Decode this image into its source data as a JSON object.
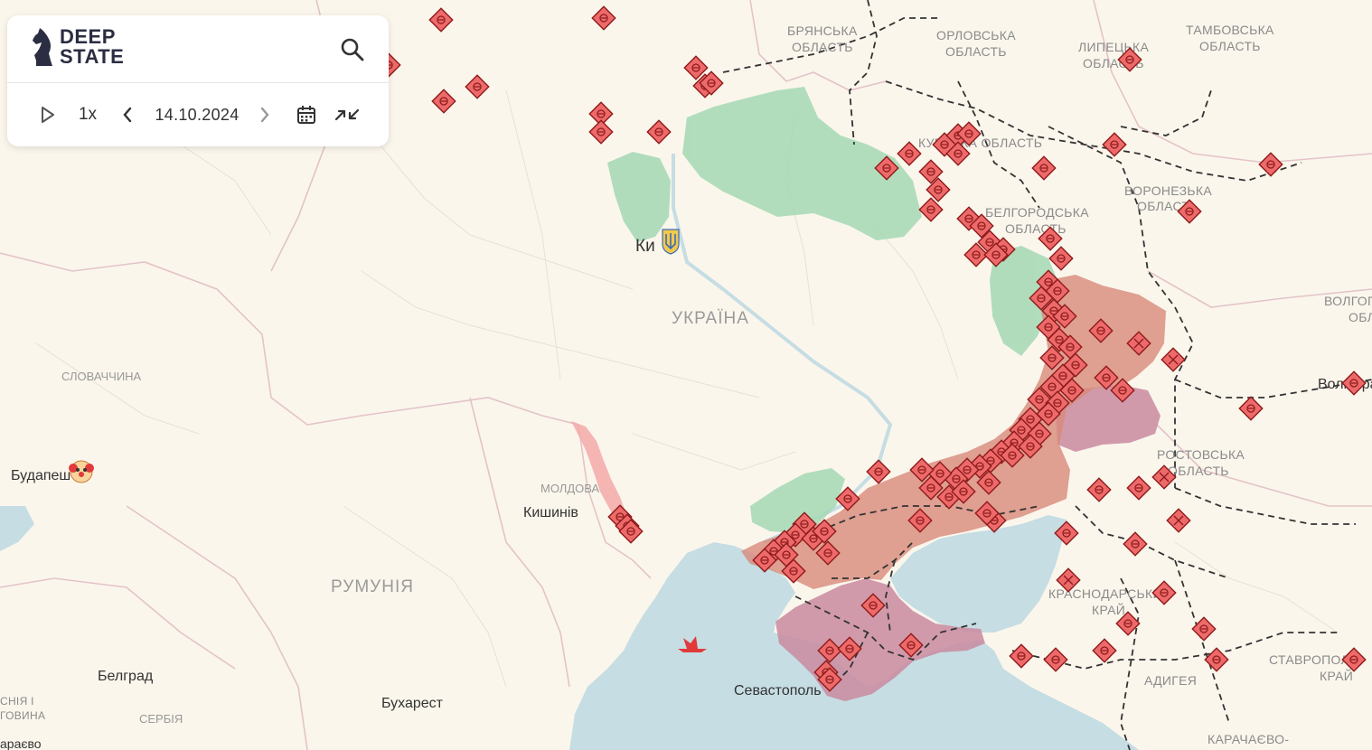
{
  "app": {
    "logo_line1": "DEEP",
    "logo_line2": "STATE"
  },
  "toolbar": {
    "search_icon": "search-icon",
    "play_icon": "play-icon",
    "speed": "1x",
    "prev_icon": "chevron-left-icon",
    "date": "14.10.2024",
    "next_icon": "chevron-right-icon",
    "calendar_icon": "calendar-icon",
    "collapse_icon": "collapse-icon"
  },
  "map": {
    "country_labels": {
      "ukraine": "УКРАЇНА",
      "romania": "РУМУНІЯ",
      "slovakia": "СЛОВАЧЧИНА",
      "moldova": "МОЛДОВА",
      "serbia": "СЕРБІЯ"
    },
    "regions": {
      "bryansk_1": "БРЯНСЬКА",
      "bryansk_2": "ОБЛАСТЬ",
      "orel_1": "ОРЛОВСЬКА",
      "orel_2": "ОБЛАСТЬ",
      "lipetsk_1": "ЛИПЕЦЬКА",
      "lipetsk_2": "ОБЛАСТЬ",
      "tambov_1": "ТАМБОВСЬКА",
      "tambov_2": "ОБЛАСТЬ",
      "kursk_1": "КУРСЬКА ОБЛАСТЬ",
      "voronezh_1": "ВОРОНЕЗЬКА",
      "voronezh_2": "ОБЛАСТЬ",
      "belgorod_1": "БЕЛГОРОДСЬКА",
      "belgorod_2": "ОБЛАСТЬ",
      "volgograd_1": "ВОЛГОГ",
      "volgograd_2": "ОБЛ",
      "rostov_1": "РОСТОВСЬКА",
      "rostov_2": "ОБЛАСТЬ",
      "krasnodar_1": "КРАСНОДАРСЬКИЙ",
      "krasnodar_2": "КРАЙ",
      "adygea": "АДИГЕЯ",
      "stavropol_1": "СТАВРОПОЛ",
      "stavropol_2": "КРАЙ",
      "karachay": "КАРАЧАЄВО-",
      "bosnia_1": "СНІЯ І",
      "bosnia_2": "ГОВИНА"
    },
    "cities": {
      "kyiv": "Ки",
      "chisinau": "Кишинів",
      "budapest": "Будапешт",
      "belgrade": "Белград",
      "bucharest": "Бухарест",
      "sevastopol": "Севастополь",
      "volgograd": "Волгоград",
      "sarajevo": "араєво"
    },
    "colors": {
      "land": "#fbf6ec",
      "sea": "#c5dde3",
      "occupied_since_2022": "#d88a7b",
      "occupied_before_2022": "#c98aa0",
      "liberated": "#9fd5b0",
      "transnistria": "#f3a9a9",
      "marker_fill": "#ee6a6a",
      "marker_stroke": "#9a1f1f",
      "border": "#dca9b7",
      "rail": "#333333"
    }
  }
}
